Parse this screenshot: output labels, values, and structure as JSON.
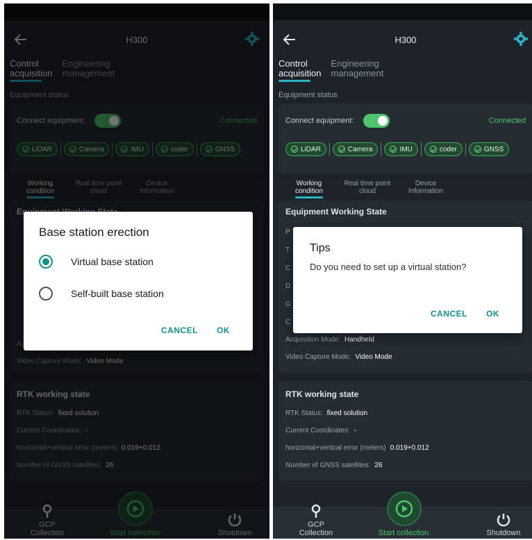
{
  "device_title": "H300",
  "top_tabs": [
    {
      "line1": "Control",
      "line2": "acquisition"
    },
    {
      "line1": "Engineering",
      "line2": "management"
    }
  ],
  "equipment_status_label": "Equipment status",
  "connect_label": "Connect equipment:",
  "connection_status": "Connected",
  "chips": [
    "LiDAR",
    "Camera",
    "IMU",
    "coder",
    "GNSS"
  ],
  "sub_tabs": [
    {
      "line1": "Working",
      "line2": "condition"
    },
    {
      "line1": "Real time point",
      "line2": "cloud"
    },
    {
      "line1": "Device",
      "line2": "Information"
    }
  ],
  "working_state": {
    "title": "Equipment Working State",
    "acquisition_mode_label": "Acquisition Mode:",
    "acquisition_mode_value": "Handheld",
    "video_capture_label": "Video Capture Mode:",
    "video_capture_value": "Video Mode",
    "stub_letters": [
      "P",
      "T",
      "C",
      "D",
      "G",
      "C"
    ]
  },
  "rtk": {
    "title": "RTK working state",
    "status_label": "RTK Status:",
    "status_value": "fixed solution",
    "coords_label": "Current Coordinates:",
    "coords_value": "-",
    "error_label": "horizontal+vertical error (meters)",
    "error_value": "0.019+0.012",
    "sats_label": "Number of GNSS satellites:",
    "sats_value": "26"
  },
  "bottom_nav": {
    "gcp": "GCP Collection",
    "start": "Start collection",
    "shutdown": "Shutdown"
  },
  "dialog_base": {
    "title": "Base station erection",
    "option_virtual": "Virtual base station",
    "option_self": "Self-built base station",
    "selected": "virtual",
    "cancel": "CANCEL",
    "ok": "OK"
  },
  "dialog_tips": {
    "title": "Tips",
    "message": "Do you need to set up a virtual station?",
    "cancel": "CANCEL",
    "ok": "OK"
  },
  "colors": {
    "accent_green": "#4fc66b",
    "accent_teal": "#12938f",
    "tab_underline": "#2bb3c7",
    "background": "#1d2328"
  }
}
